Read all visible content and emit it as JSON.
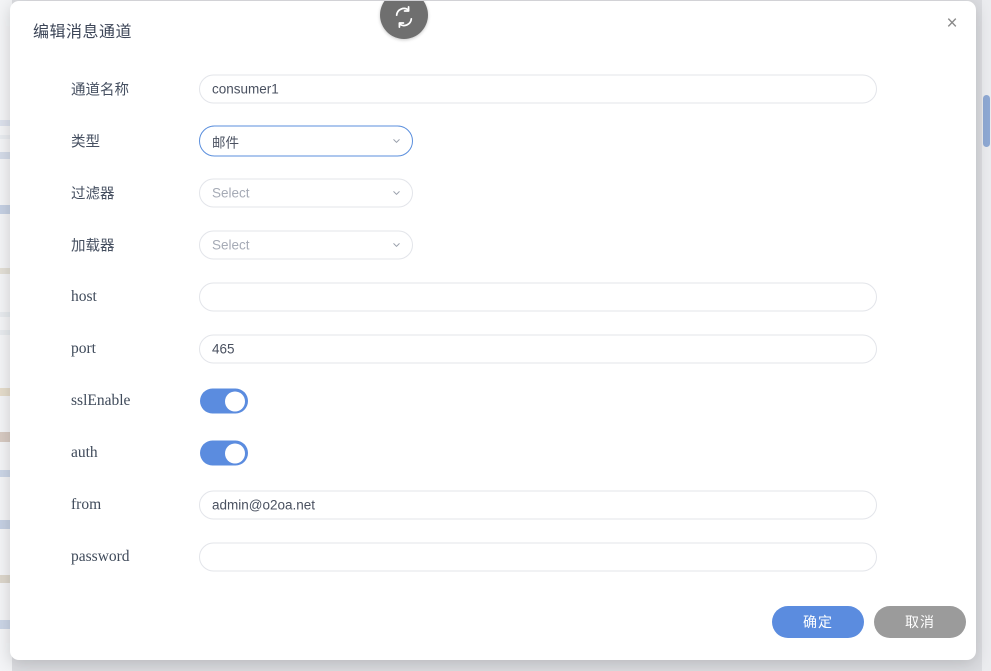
{
  "window": {
    "background_color": "#dcdde1",
    "modal_bg": "#ffffff",
    "accent_color": "#5b8cdf",
    "cancel_color": "#9b9b9b",
    "scrollbar_thumb_color": "#8fa9d4"
  },
  "header": {
    "title": "编辑消息通道",
    "refresh_icon": "refresh-icon",
    "close_icon": "close-icon",
    "close_label": "×"
  },
  "form": {
    "rows": [
      {
        "label": "通道名称",
        "kind": "text",
        "value": "consumer1",
        "placeholder": ""
      },
      {
        "label": "类型",
        "kind": "select",
        "value": "邮件",
        "placeholder": "Select",
        "active": true
      },
      {
        "label": "过滤器",
        "kind": "select",
        "value": "",
        "placeholder": "Select",
        "active": false
      },
      {
        "label": "加载器",
        "kind": "select",
        "value": "",
        "placeholder": "Select",
        "active": false
      },
      {
        "label": "host",
        "kind": "text",
        "value": "",
        "placeholder": ""
      },
      {
        "label": "port",
        "kind": "text",
        "value": "465",
        "placeholder": ""
      },
      {
        "label": "sslEnable",
        "kind": "toggle",
        "value": "on"
      },
      {
        "label": "auth",
        "kind": "toggle",
        "value": "on"
      },
      {
        "label": "from",
        "kind": "text",
        "value": "admin@o2oa.net",
        "placeholder": ""
      },
      {
        "label": "password",
        "kind": "text",
        "value": "",
        "placeholder": ""
      }
    ]
  },
  "footer": {
    "confirm_label": "确定",
    "cancel_label": "取消"
  }
}
